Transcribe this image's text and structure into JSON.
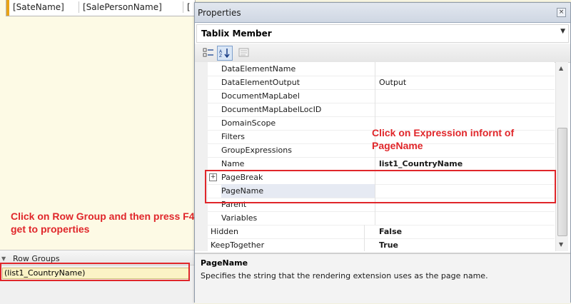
{
  "designer": {
    "columns": [
      "[SateName]",
      "[SalePersonName]",
      "["
    ]
  },
  "row_groups": {
    "header_label": "Row Groups",
    "item": "(list1_CountryName)"
  },
  "annotations": {
    "left": "Click on Row Group and then press F4 to get to properties",
    "right": "Click on Expression infornt of PageName"
  },
  "properties": {
    "title": "Properties",
    "object_name": "Tablix Member",
    "toolbar": {
      "categorized_icon": "categorized-icon",
      "alphabetical_icon": "alphabetical-icon",
      "property_pages_icon": "property-pages-icon"
    },
    "rows": [
      {
        "name": "DataElementName",
        "value": ""
      },
      {
        "name": "DataElementOutput",
        "value": "Output"
      },
      {
        "name": "DocumentMapLabel",
        "value": ""
      },
      {
        "name": "DocumentMapLabelLocID",
        "value": ""
      },
      {
        "name": "DomainScope",
        "value": ""
      },
      {
        "name": "Filters",
        "value": ""
      },
      {
        "name": "GroupExpressions",
        "value": ""
      },
      {
        "name": "Name",
        "value": "list1_CountryName"
      },
      {
        "name": "PageBreak",
        "value": ""
      },
      {
        "name": "PageName",
        "value": ""
      },
      {
        "name": "Parent",
        "value": ""
      },
      {
        "name": "Variables",
        "value": ""
      },
      {
        "name": "Hidden",
        "value": "False"
      },
      {
        "name": "KeepTogether",
        "value": "True"
      }
    ],
    "description": {
      "title": "PageName",
      "text": "Specifies the string that the rendering extension uses as the page name."
    }
  },
  "colors": {
    "annotation": "#e0262a",
    "selection": "#e6eaf3"
  }
}
